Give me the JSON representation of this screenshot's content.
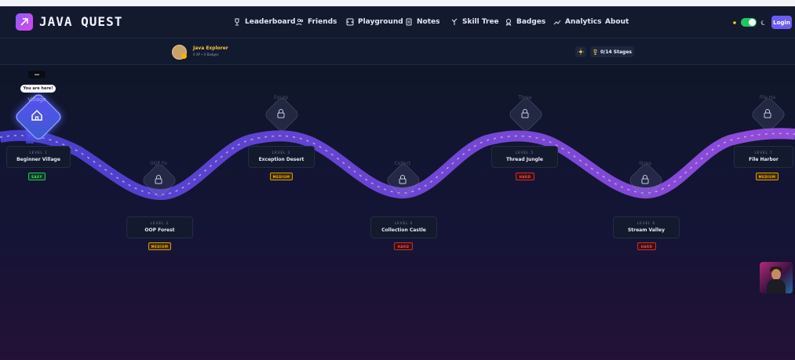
{
  "app": {
    "title": "JAVA QUEST"
  },
  "nav": {
    "items": [
      {
        "label": "Leaderboard",
        "icon": "trophy-icon"
      },
      {
        "label": "Friends",
        "icon": "users-icon"
      },
      {
        "label": "Playground",
        "icon": "code-icon"
      },
      {
        "label": "Notes",
        "icon": "notes-icon"
      },
      {
        "label": "Skill Tree",
        "icon": "tree-icon"
      },
      {
        "label": "Badges",
        "icon": "badge-icon"
      },
      {
        "label": "Analytics",
        "icon": "trend-icon"
      },
      {
        "label": "About",
        "icon": ""
      }
    ],
    "login_label": "Login",
    "theme_dark": true
  },
  "profile": {
    "name": "Java Explorer",
    "sub": "0 XP • 0 Badges",
    "stages": "0/14 Stages"
  },
  "map": {
    "here_label": "You are here!",
    "levels": [
      {
        "level": "LEVEL 1",
        "name": "Beginner Village",
        "ghost": "Village",
        "difficulty": "EASY",
        "locked": false
      },
      {
        "level": "LEVEL 2",
        "name": "OOP Forest",
        "ghost": "OOP Fo",
        "difficulty": "MEDIUM",
        "locked": true
      },
      {
        "level": "LEVEL 3",
        "name": "Exception Desert",
        "ghost": "Excep",
        "difficulty": "MEDIUM",
        "locked": true
      },
      {
        "level": "LEVEL 4",
        "name": "Collection Castle",
        "ghost": "Collect",
        "difficulty": "HARD",
        "locked": true
      },
      {
        "level": "LEVEL 5",
        "name": "Thread Jungle",
        "ghost": "Threa",
        "difficulty": "HARD",
        "locked": true
      },
      {
        "level": "LEVEL 6",
        "name": "Stream Valley",
        "ghost": "Strea",
        "difficulty": "HARD",
        "locked": true
      },
      {
        "level": "LEVEL 7",
        "name": "File Harbor",
        "ghost": "File Ha",
        "difficulty": "MEDIUM",
        "locked": true
      }
    ]
  },
  "colors": {
    "accent": "#6d5bf5",
    "path_start": "#4f46e5",
    "path_end": "#a855f7"
  }
}
